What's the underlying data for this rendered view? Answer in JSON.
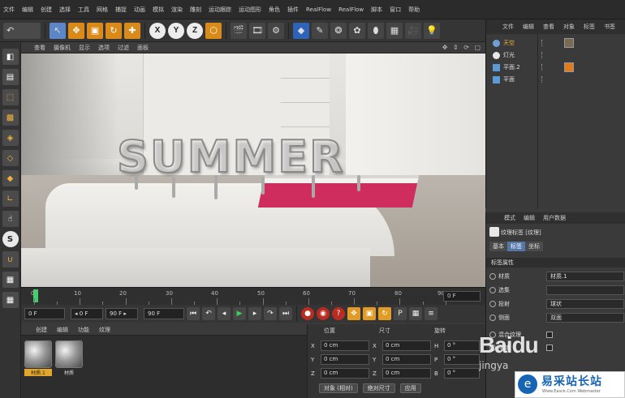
{
  "menubar": {
    "items": [
      "文件",
      "编辑",
      "创建",
      "选择",
      "工具",
      "网格",
      "捕捉",
      "动画",
      "模拟",
      "渲染",
      "雕刻",
      "运动跟踪",
      "运动图形",
      "角色",
      "插件",
      "RealFlow",
      "RealFlow",
      "脚本",
      "窗口",
      "帮助"
    ]
  },
  "toolbar": {
    "undo_icon": "undo-icon",
    "axes": [
      "X",
      "Y",
      "Z"
    ]
  },
  "viewport": {
    "menu": [
      "查看",
      "摄像机",
      "显示",
      "选项",
      "过滤",
      "面板"
    ],
    "scene_text": "SUMMER",
    "nav_icons": "✥ ⇕ ⟳ ▢"
  },
  "timeline": {
    "ticks": [
      "0",
      "10",
      "20",
      "30",
      "40",
      "50",
      "60",
      "70",
      "80",
      "90"
    ],
    "frame": "0 F"
  },
  "transport": {
    "start": "0 F",
    "range_start": "◂ 0 F",
    "range_end": "90 F ▸",
    "end": "90 F"
  },
  "materials": {
    "menu": [
      "创建",
      "编辑",
      "功能",
      "纹理"
    ],
    "items": [
      {
        "label": "材质.1",
        "selected": true
      },
      {
        "label": "材质",
        "selected": false
      }
    ]
  },
  "coords": {
    "headers": [
      "位置",
      "尺寸",
      "旋转"
    ],
    "rows": [
      {
        "axis": "X",
        "pos": "0 cm",
        "size_axis": "X",
        "size": "0 cm",
        "rot_axis": "H",
        "rot": "0 °"
      },
      {
        "axis": "Y",
        "pos": "0 cm",
        "size_axis": "Y",
        "size": "0 cm",
        "rot_axis": "P",
        "rot": "0 °"
      },
      {
        "axis": "Z",
        "pos": "0 cm",
        "size_axis": "Z",
        "size": "0 cm",
        "rot_axis": "B",
        "rot": "0 °"
      }
    ],
    "mode": "对象 (相对)",
    "size_mode": "绝对尺寸",
    "apply": "应用"
  },
  "objects": {
    "tabs": [
      "文件",
      "编辑",
      "查看",
      "对象",
      "标签",
      "书签"
    ],
    "rows": [
      {
        "name": "天空",
        "selected": true
      },
      {
        "name": "灯光",
        "selected": false
      },
      {
        "name": "平面.2",
        "selected": false
      },
      {
        "name": "平面",
        "selected": false
      }
    ]
  },
  "attributes": {
    "tabs": [
      "模式",
      "编辑",
      "用户数据"
    ],
    "title": "纹理标签 [纹理]",
    "subtabs": [
      "基本",
      "标签",
      "坐标"
    ],
    "section": "标签属性",
    "rows": [
      {
        "label": "材质",
        "value": "材质.1"
      },
      {
        "label": "选集",
        "value": ""
      },
      {
        "label": "投射",
        "value": "球状"
      },
      {
        "label": "侧面",
        "value": "双面"
      },
      {
        "label": "混合纹理",
        "value": ""
      },
      {
        "label": "平铺",
        "value": ""
      }
    ]
  },
  "watermark": {
    "baidu": "Baidu",
    "baidu_sub": "jingya",
    "site": "易采站长站",
    "site_url": "Www.Easck.Com Webmaster"
  },
  "colors": {
    "accent": "#f1b637",
    "selection": "#5576a8",
    "playhead": "#3fd06a"
  }
}
